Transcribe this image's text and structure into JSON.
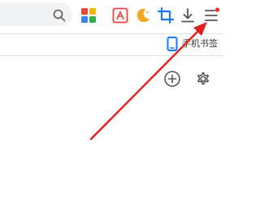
{
  "toolbar": {
    "search_icon": "search-icon",
    "extensions": [
      {
        "name": "apps-grid",
        "icon": "apps-grid-icon"
      },
      {
        "name": "pdf",
        "icon": "pdf-icon"
      },
      {
        "name": "night-mode",
        "icon": "moon-icon"
      },
      {
        "name": "screenshot",
        "icon": "crop-icon"
      },
      {
        "name": "download",
        "icon": "download-icon"
      },
      {
        "name": "main-menu",
        "icon": "menu-icon",
        "has_notification_dot": true
      }
    ]
  },
  "bookmarks_bar": {
    "phone_bookmark_label": "手机书签"
  },
  "panel": {
    "add_icon": "plus-circle-icon",
    "settings_icon": "gear-icon"
  },
  "annotation": {
    "type": "arrow",
    "target": "main-menu",
    "color": "#e0201c"
  },
  "colors": {
    "apps_red": "#e8453c",
    "apps_yellow": "#f5b400",
    "apps_green": "#2bb24c",
    "apps_blue": "#3b82f6",
    "pdf_red": "#e8453c",
    "moon_yellow": "#f5a623",
    "crop_blue": "#1677ff",
    "phone_blue": "#1677ff",
    "icon_gray": "#555555",
    "notification_red": "#f02c2c",
    "arrow_red": "#e0201c"
  }
}
